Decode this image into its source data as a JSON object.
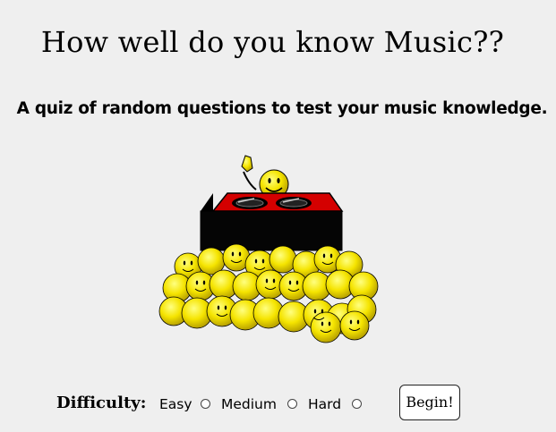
{
  "header": {
    "title": "How well do you know Music??",
    "subtitle": "A quiz of random questions to test your music knowledge."
  },
  "illustration": {
    "icon": "dj-smiley-crowd-icon",
    "colors": {
      "smiley": "#f5e400",
      "deck": "#d40000",
      "booth": "#000000"
    }
  },
  "controls": {
    "difficulty_label": "Difficulty:",
    "options": [
      {
        "label": "Easy",
        "selected": false
      },
      {
        "label": "Medium",
        "selected": false
      },
      {
        "label": "Hard",
        "selected": false
      }
    ],
    "begin_label": "Begin!"
  }
}
